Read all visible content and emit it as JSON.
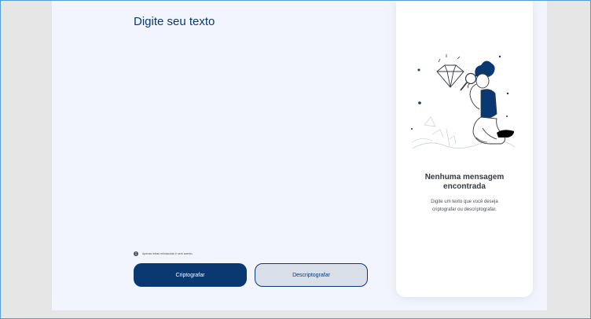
{
  "input": {
    "placeholder": "Digite seu texto",
    "value": ""
  },
  "notice": {
    "icon": "info-icon",
    "text": "Apenas letras minúsculas e sem acento."
  },
  "buttons": {
    "encrypt_label": "Criptografar",
    "decrypt_label": "Descriptografar"
  },
  "result": {
    "illustration": "person-with-magnifier-illustration",
    "title_line1": "Nenhuma mensagem",
    "title_line2": "encontrada",
    "desc_line1": "Digite um texto que você deseja",
    "desc_line2": "criptografar ou descriptografar."
  },
  "colors": {
    "primary": "#0a3871",
    "background": "#f2f5fd",
    "secondary_button": "#d8dfe8",
    "card": "#ffffff",
    "frame": "#e6e6e6"
  }
}
